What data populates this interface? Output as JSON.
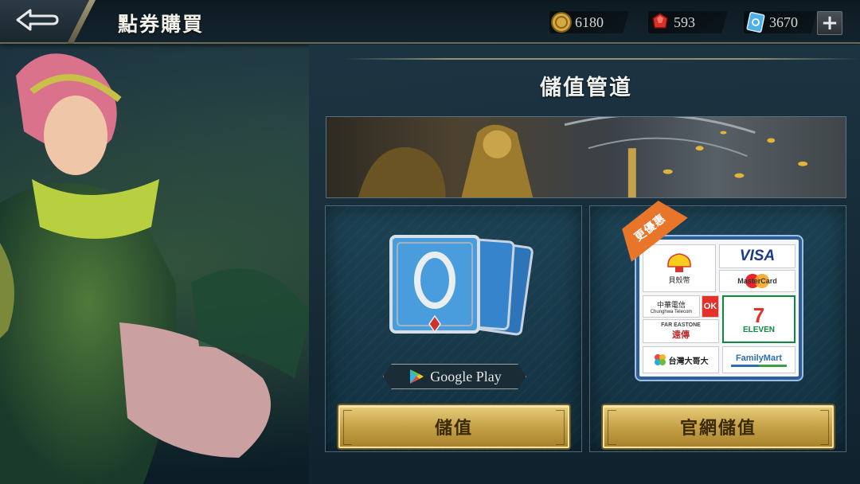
{
  "header": {
    "title": "點券購買",
    "currencies": [
      {
        "name": "gold-coin",
        "value": "6180",
        "color": "#d4a940"
      },
      {
        "name": "red-gem",
        "value": "593",
        "color": "#d9302a"
      },
      {
        "name": "diamond-voucher",
        "value": "3670",
        "color": "#4db0e8"
      }
    ],
    "add_label": "+"
  },
  "main": {
    "section_title": "儲值管道",
    "google_play": {
      "badge_label": "Google Play",
      "button_label": "儲值"
    },
    "official_site": {
      "ribbon_label": "更優惠",
      "button_label": "官網儲值",
      "logos": {
        "shell": "貝殼幣",
        "visa": "VISA",
        "mastercard": "MasterCard",
        "cht_name": "中華電信",
        "cht_en": "Chunghwa Telecom",
        "ok": "OK",
        "fareastone_en": "FAR EASTONE",
        "fareastone_zh": "遠傳",
        "seven_number": "7",
        "seven_brand": "ELEVEN",
        "taiwan_mobile": "台灣大哥大",
        "familymart": "FamilyMart"
      }
    }
  }
}
